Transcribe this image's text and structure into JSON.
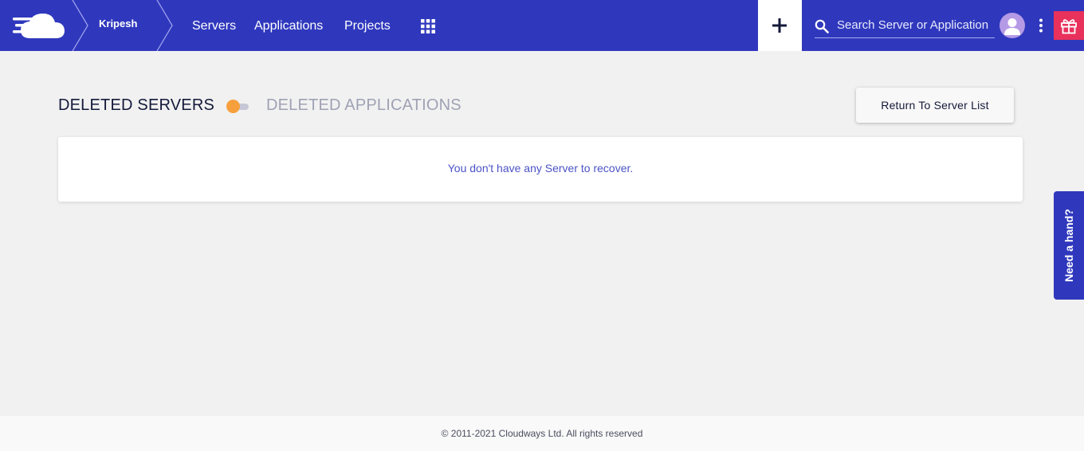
{
  "header": {
    "user_name": "Kripesh",
    "nav": {
      "servers": "Servers",
      "applications": "Applications",
      "projects": "Projects"
    },
    "search_placeholder": "Search Server or Application",
    "icons": [
      "cloudways-logo-icon",
      "apps-grid-icon",
      "plus-icon",
      "search-icon",
      "user-avatar-icon",
      "more-vert-icon",
      "gift-icon"
    ]
  },
  "page": {
    "deleted_servers_label": "DELETED SERVERS",
    "deleted_applications_label": "DELETED APPLICATIONS",
    "return_button_label": "Return To Server List",
    "empty_message": "You don't have any Server to recover."
  },
  "help_tab_label": "Need a hand?",
  "footer": {
    "copyright": "© 2011-2021 Cloudways Ltd. All rights reserved"
  },
  "colors": {
    "brand": "#2f38bd",
    "accent_orange": "#f6a03d",
    "gift": "#e8315b",
    "background": "#f1f1f1"
  }
}
